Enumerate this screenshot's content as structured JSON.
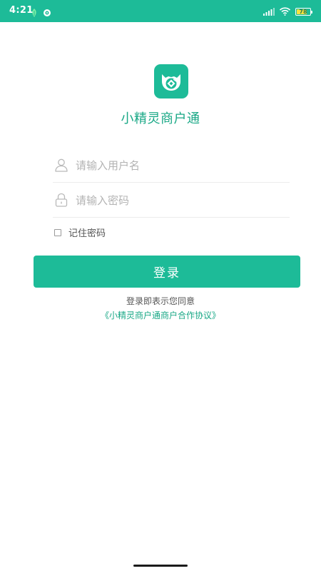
{
  "status_bar": {
    "time": "4:21",
    "battery_level": "78",
    "battery_fraction": 0.78,
    "icons": [
      "leaf-icon",
      "notification-app-icon",
      "signal-icon",
      "wifi-icon",
      "battery-icon"
    ]
  },
  "app": {
    "logo_icon": "owl-logo-icon",
    "name": "小精灵商户通"
  },
  "form": {
    "username": {
      "icon": "user-icon",
      "value": "",
      "placeholder": "请输入用户名"
    },
    "password": {
      "icon": "lock-icon",
      "value": "",
      "placeholder": "请输入密码"
    },
    "remember": {
      "label": "记住密码",
      "checked": false
    },
    "login_label": "登录"
  },
  "agreement": {
    "prefix": "登录即表示您同意",
    "link_text": "《小精灵商户通商户合作协议》"
  },
  "colors": {
    "accent": "#1dbb98",
    "accent_text": "#19a886",
    "placeholder": "#b3b3b3",
    "divider": "#ececec"
  }
}
